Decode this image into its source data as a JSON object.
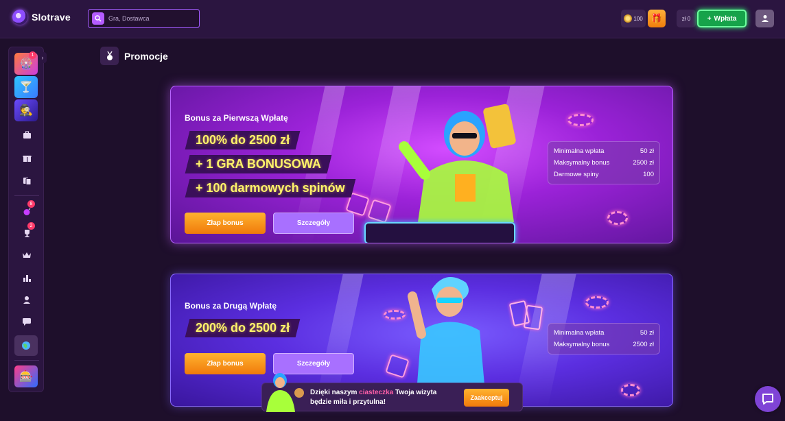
{
  "header": {
    "logo_text": "Slotrave",
    "search_placeholder": "Gra, Dostawca",
    "coins": "100",
    "balance": "zł 0",
    "deposit_label": "Wpłata",
    "deposit_plus": "+"
  },
  "sidebar": {
    "badges": {
      "game1": "1",
      "bomb": "8",
      "trophy": "2"
    },
    "items": [
      {
        "icon": "briefcase-icon"
      },
      {
        "icon": "gift-icon"
      },
      {
        "icon": "cards-icon"
      },
      {
        "icon": "bomb-icon"
      },
      {
        "icon": "trophy-icon"
      },
      {
        "icon": "crown-icon"
      },
      {
        "icon": "podium-icon"
      },
      {
        "icon": "user-icon"
      },
      {
        "icon": "chat-icon"
      },
      {
        "icon": "globe-icon"
      }
    ]
  },
  "page": {
    "title": "Promocje"
  },
  "promos": [
    {
      "title": "Bonus za Pierwszą Wpłatę",
      "lines": [
        "100% do 2500 zł",
        "+ 1 GRA BONUSOWA",
        "+ 100 darmowych spinów"
      ],
      "primary_label": "Złap bonus",
      "secondary_label": "Szczegóły",
      "stats": [
        {
          "label": "Minimalna wpłata",
          "value": "50 zł"
        },
        {
          "label": "Maksymalny bonus",
          "value": "2500 zł"
        },
        {
          "label": "Darmowe spiny",
          "value": "100"
        }
      ]
    },
    {
      "title": "Bonus za Drugą Wpłatę",
      "lines": [
        "200% do 2500 zł"
      ],
      "primary_label": "Złap bonus",
      "secondary_label": "Szczegóły",
      "stats": [
        {
          "label": "Minimalna wpłata",
          "value": "50 zł"
        },
        {
          "label": "Maksymalny bonus",
          "value": "2500 zł"
        }
      ]
    }
  ],
  "cookie": {
    "text_before": "Dzięki naszym ",
    "highlight": "ciasteczka",
    "text_after": " Twoja wizyta będzie miła i przytulna!",
    "accept_label": "Zaakceptuj"
  },
  "colors": {
    "background": "#1e0f2b",
    "topbar": "#2b1540",
    "accent_orange": "#f59e0b",
    "accent_green": "#16a34a",
    "promo_yellow": "#fff36a",
    "cookie_highlight": "#ff5fa8"
  }
}
